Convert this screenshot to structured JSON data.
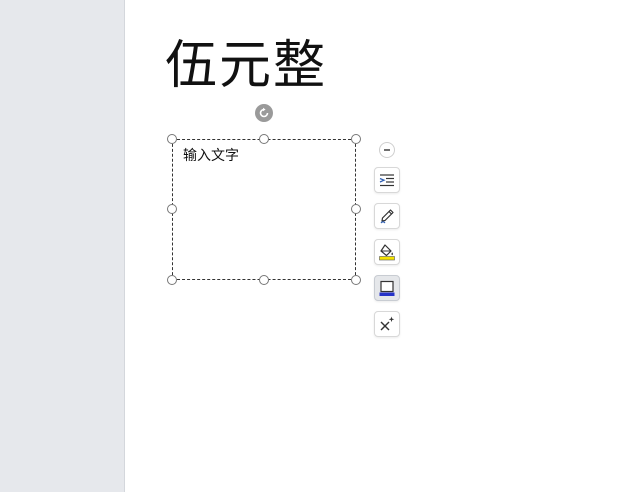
{
  "document": {
    "title": "伍元整",
    "textbox": {
      "text": "输入文字"
    }
  },
  "toolbar": {
    "tools": [
      {
        "id": "collapse",
        "icon": "minus-circle-icon"
      },
      {
        "id": "text-wrap",
        "icon": "text-wrap-icon"
      },
      {
        "id": "outline",
        "icon": "pen-icon"
      },
      {
        "id": "fill",
        "icon": "paint-bucket-icon"
      },
      {
        "id": "shape-style",
        "icon": "shape-style-icon"
      },
      {
        "id": "effects",
        "icon": "magic-wand-icon"
      }
    ]
  },
  "colors": {
    "sidebar": "#e6e8ec",
    "accent_blue": "#2633c8",
    "fill_yellow": "#f5e300"
  }
}
